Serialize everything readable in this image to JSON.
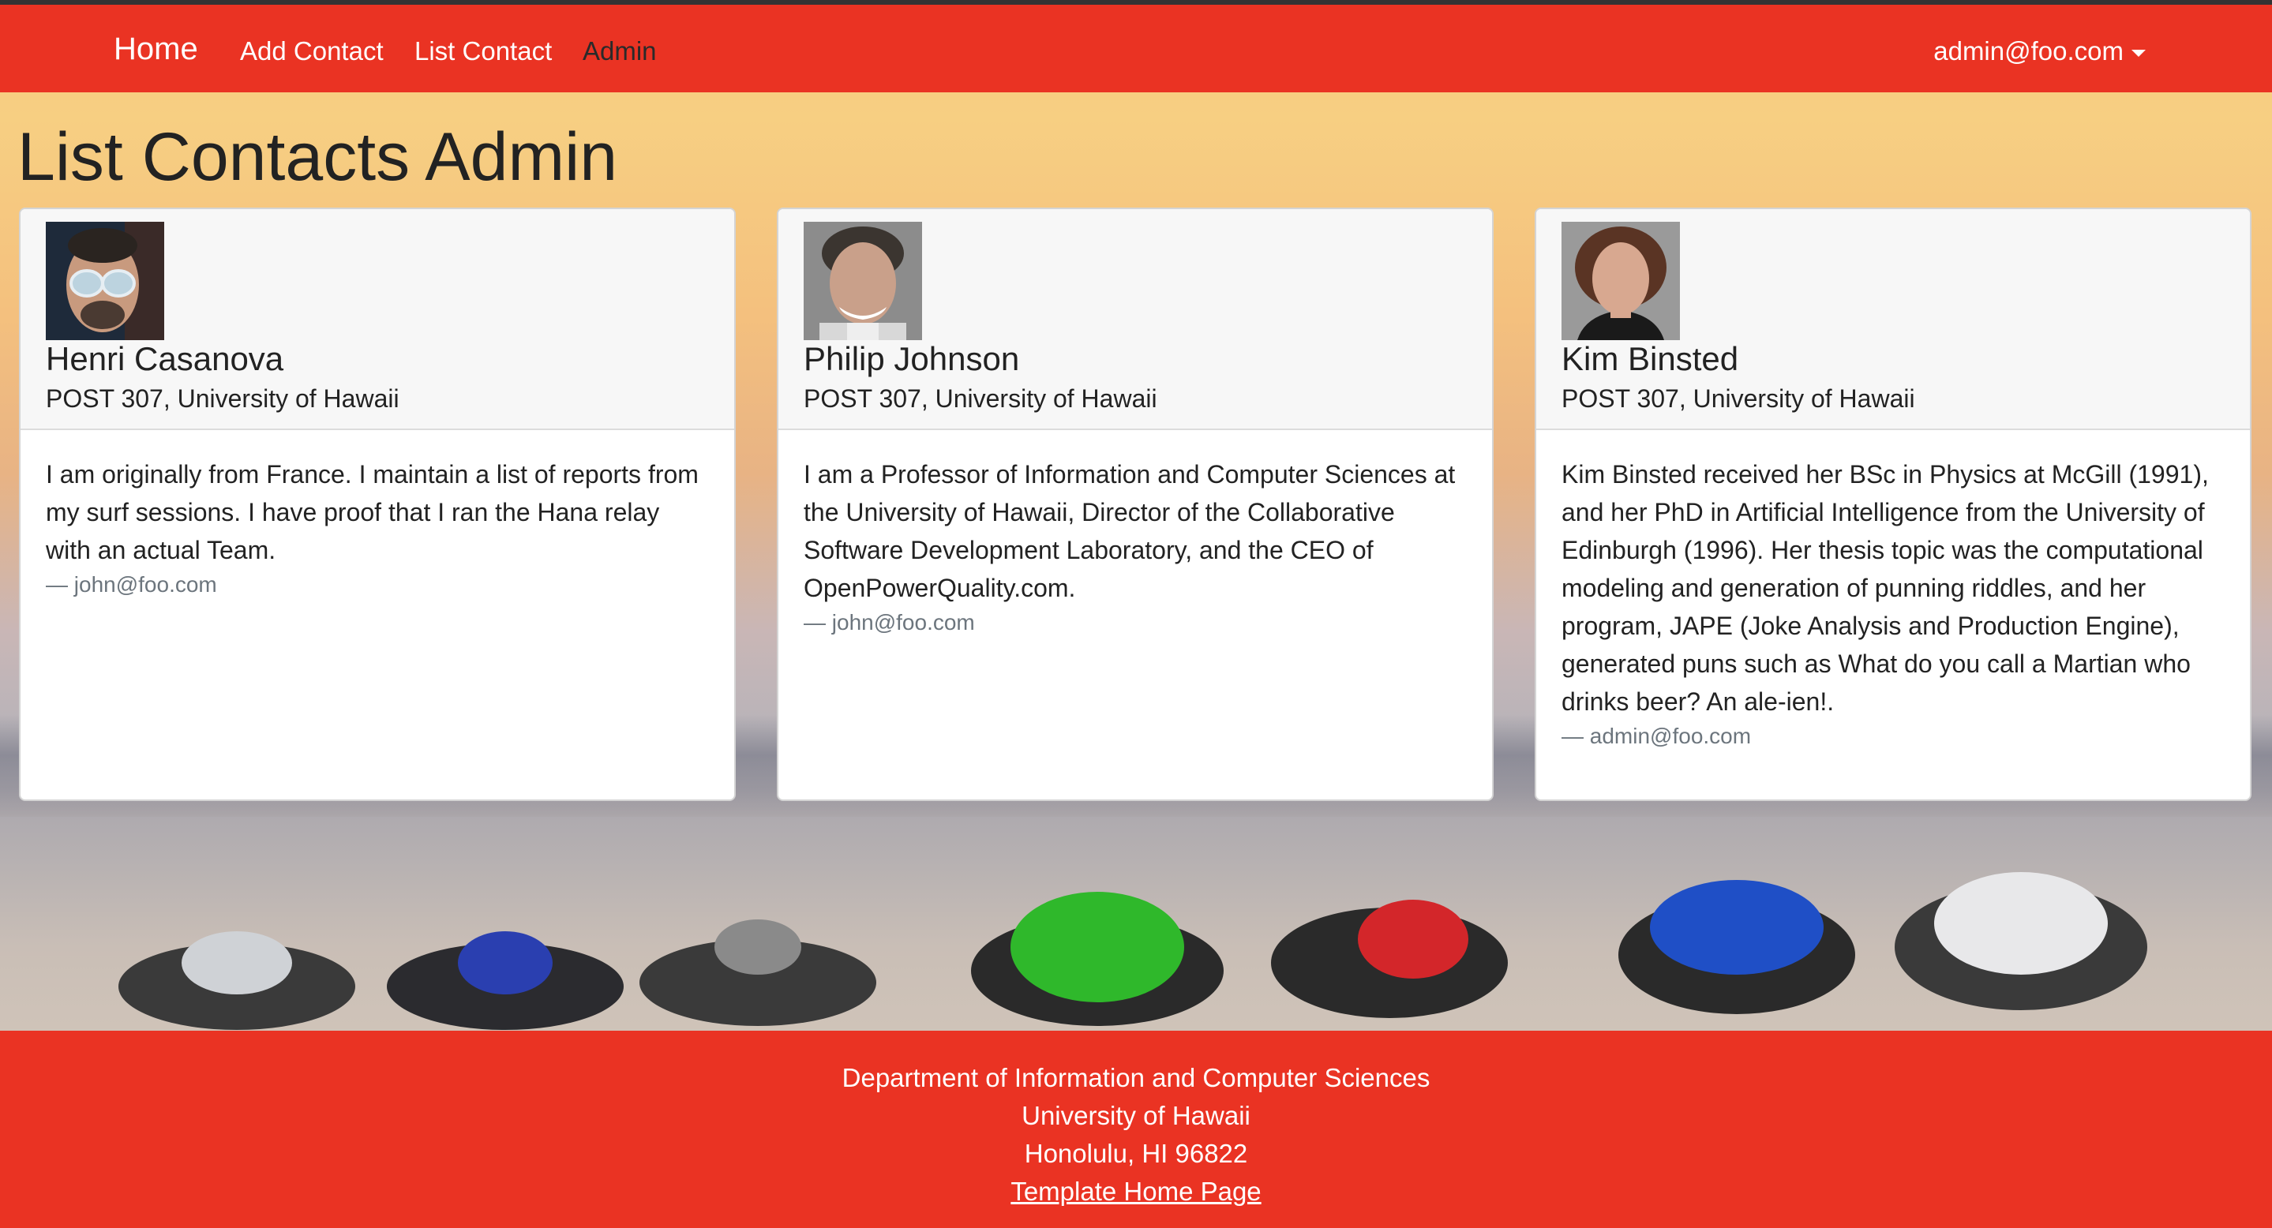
{
  "nav": {
    "brand": "Home",
    "links": [
      "Add Contact",
      "List Contact",
      "Admin"
    ],
    "user": "admin@foo.com"
  },
  "page": {
    "title": "List Contacts Admin"
  },
  "contacts": [
    {
      "name": "Henri Casanova",
      "address": "POST 307, University of Hawaii",
      "description": "I am originally from France. I maintain a list of reports from my surf sessions. I have proof that I ran the Hana relay with an actual Team.",
      "owner": "— john@foo.com"
    },
    {
      "name": "Philip Johnson",
      "address": "POST 307, University of Hawaii",
      "description": "I am a Professor of Information and Computer Sciences at the University of Hawaii, Director of the Collaborative Software Development Laboratory, and the CEO of OpenPowerQuality.com.",
      "owner": "— john@foo.com"
    },
    {
      "name": "Kim Binsted",
      "address": "POST 307, University of Hawaii",
      "description": "Kim Binsted received her BSc in Physics at McGill (1991), and her PhD in Artificial Intelligence from the University of Edinburgh (1996). Her thesis topic was the computational modeling and generation of punning riddles, and her program, JAPE (Joke Analysis and Production Engine), generated puns such as What do you call a Martian who drinks beer? An ale-ien!.",
      "owner": "— admin@foo.com"
    }
  ],
  "footer": {
    "lines": [
      "Department of Information and Computer Sciences",
      "University of Hawaii",
      "Honolulu, HI 96822"
    ],
    "link": "Template Home Page"
  },
  "colors": {
    "brand_red": "#ea3323",
    "nav_active": "#2a2a2a"
  }
}
